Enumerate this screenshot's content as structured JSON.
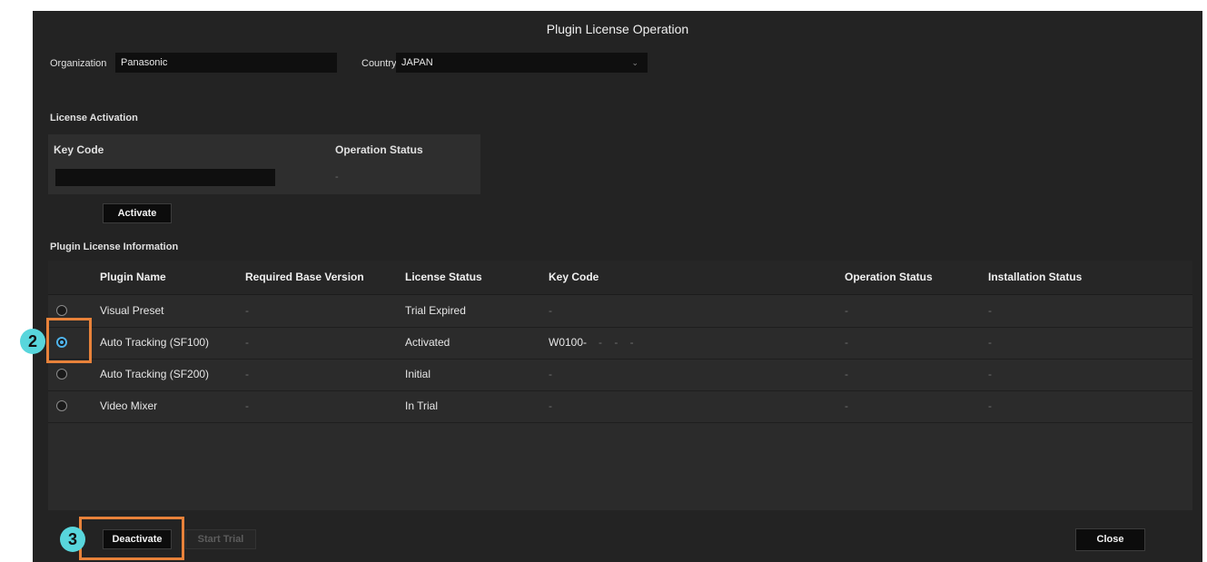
{
  "window": {
    "title": "Plugin License Operation"
  },
  "org": {
    "label": "Organization",
    "value": "Panasonic"
  },
  "country": {
    "label": "Country",
    "value": "JAPAN"
  },
  "activation": {
    "title": "License Activation",
    "key_code_header": "Key Code",
    "status_header": "Operation Status",
    "key_code_value": "",
    "status_value": "-",
    "activate_label": "Activate"
  },
  "plugins": {
    "title": "Plugin License Information",
    "headers": [
      "Plugin Name",
      "Required Base Version",
      "License Status",
      "Key Code",
      "Operation Status",
      "Installation Status"
    ],
    "rows": [
      {
        "name": "Visual Preset",
        "base": "-",
        "status": "Trial Expired",
        "key": "-",
        "op": "-",
        "inst": "-",
        "selected": false
      },
      {
        "name": "Auto Tracking (SF100)",
        "base": "-",
        "status": "Activated",
        "key": "W0100-",
        "key_tail": "-    -    -",
        "op": "-",
        "inst": "-",
        "selected": true
      },
      {
        "name": "Auto Tracking (SF200)",
        "base": "-",
        "status": "Initial",
        "key": "-",
        "op": "-",
        "inst": "-",
        "selected": false
      },
      {
        "name": "Video Mixer",
        "base": "-",
        "status": "In Trial",
        "key": "-",
        "op": "-",
        "inst": "-",
        "selected": false
      }
    ]
  },
  "buttons": {
    "deactivate": "Deactivate",
    "start_trial": "Start Trial",
    "close": "Close"
  },
  "callouts": {
    "step2": "2",
    "step3": "3"
  },
  "colors": {
    "accent": "#4fb3ea",
    "callout": "#e8823a",
    "badge": "#58d6dc"
  }
}
